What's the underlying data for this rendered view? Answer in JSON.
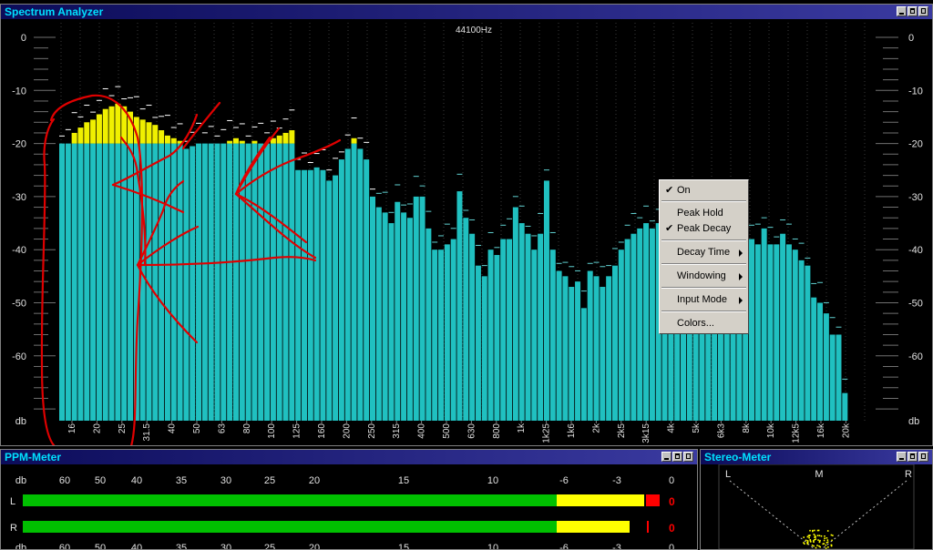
{
  "spectrum": {
    "title": "Spectrum Analyzer",
    "sample_rate": "44100Hz",
    "db_labels_left": [
      "0",
      "-10",
      "-20",
      "-30",
      "-40",
      "-50",
      "-60",
      "db"
    ],
    "db_labels_right": [
      "0",
      "-10",
      "-20",
      "-30",
      "-40",
      "-50",
      "-60",
      "db"
    ],
    "freq_labels": [
      "16",
      "20",
      "25",
      "31.5",
      "40",
      "50",
      "63",
      "80",
      "100",
      "125",
      "160",
      "200",
      "250",
      "315",
      "400",
      "500",
      "630",
      "800",
      "1k",
      "1k25",
      "1k6",
      "2k",
      "2k5",
      "3k15",
      "4k",
      "5k",
      "6k3",
      "8k",
      "10k",
      "12k5",
      "16k",
      "20k"
    ],
    "colors": {
      "bar": "#20c0c0",
      "peak_overlay": "#f0f000",
      "peak_marker": "#ffffff",
      "annotation": "#e00000"
    },
    "bars_db": [
      -20,
      -20,
      -20,
      -20,
      -20,
      -20,
      -20,
      -20,
      -20,
      -20,
      -20,
      -20,
      -20,
      -20,
      -20,
      -20,
      -20,
      -20,
      -20,
      -20,
      -21,
      -20.5,
      -20,
      -20,
      -20,
      -20,
      -20,
      -20,
      -20,
      -20,
      -20,
      -20,
      -20,
      -20,
      -20,
      -20,
      -20,
      -20,
      -25,
      -25,
      -25,
      -24.5,
      -25,
      -27,
      -26,
      -23,
      -21,
      -20,
      -21,
      -23,
      -30,
      -32,
      -33,
      -35,
      -31,
      -33,
      -34,
      -30,
      -30,
      -36,
      -40,
      -40,
      -39,
      -38,
      -29,
      -34,
      -37,
      -43,
      -45,
      -40,
      -41,
      -38,
      -38,
      -32,
      -35,
      -37,
      -40,
      -37,
      -27,
      -40,
      -44,
      -45,
      -47,
      -46,
      -51,
      -44,
      -45,
      -47,
      -45,
      -43,
      -40,
      -38,
      -37,
      -36,
      -35,
      -36,
      -35,
      -32,
      -39,
      -38,
      -40,
      -36,
      -39,
      -38,
      -36,
      -36,
      -37,
      -36,
      -37,
      -38,
      -40,
      -38,
      -39,
      -36,
      -39,
      -39,
      -37,
      -39,
      -40,
      -42,
      -43,
      -49,
      -50,
      -52,
      -56,
      -56,
      -67
    ],
    "peak_overlay_db": [
      -20,
      -20,
      -18,
      -17,
      -16,
      -15.5,
      -14.5,
      -13.5,
      -13,
      -12.5,
      -13,
      -14,
      -15,
      -15.5,
      -16,
      -16.5,
      -17.5,
      -18.5,
      -19,
      -19.5,
      null,
      null,
      null,
      null,
      null,
      null,
      null,
      -19.5,
      -19,
      -19.5,
      null,
      -19.5,
      null,
      null,
      -19,
      -18.5,
      -18,
      -17.5,
      null,
      null,
      null,
      null,
      null,
      null,
      null,
      null,
      null,
      -19
    ]
  },
  "context_menu": {
    "items": [
      {
        "label": "On",
        "checked": true,
        "submenu": false
      },
      {
        "label": "Peak Hold",
        "checked": false,
        "submenu": false
      },
      {
        "label": "Peak Decay",
        "checked": true,
        "submenu": false
      },
      {
        "label": "Decay Time",
        "checked": false,
        "submenu": true
      },
      {
        "label": "Windowing",
        "checked": false,
        "submenu": true
      },
      {
        "label": "Input Mode",
        "checked": false,
        "submenu": true
      },
      {
        "label": "Colors...",
        "checked": false,
        "submenu": false
      }
    ],
    "check_glyph": "✔"
  },
  "ppm": {
    "title": "PPM-Meter",
    "scale": [
      "db",
      "60",
      "50",
      "40",
      "35",
      "30",
      "25",
      "20",
      "15",
      "10",
      "-6",
      "-3",
      "0"
    ],
    "channels": [
      {
        "label": "L",
        "level_db": 0,
        "clip": true,
        "peak_readout": "0"
      },
      {
        "label": "R",
        "level_db": -1,
        "clip": false,
        "peak_readout": "0"
      }
    ],
    "colors": {
      "green": "#00c000",
      "yellow": "#ffff00",
      "red": "#ff0000"
    }
  },
  "stereo": {
    "title": "Stereo-Meter",
    "labels": {
      "left": "L",
      "mid": "M",
      "right": "R"
    },
    "dot_color": "#ffff00"
  }
}
